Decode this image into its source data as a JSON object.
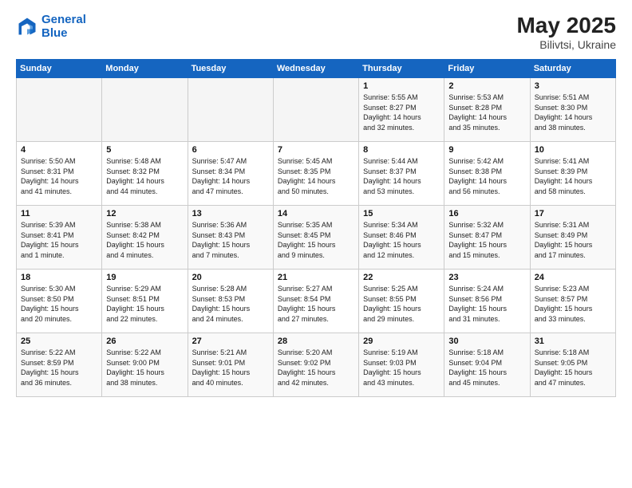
{
  "logo": {
    "line1": "General",
    "line2": "Blue"
  },
  "title": "May 2025",
  "subtitle": "Bilivtsi, Ukraine",
  "weekdays": [
    "Sunday",
    "Monday",
    "Tuesday",
    "Wednesday",
    "Thursday",
    "Friday",
    "Saturday"
  ],
  "weeks": [
    [
      {
        "day": "",
        "info": ""
      },
      {
        "day": "",
        "info": ""
      },
      {
        "day": "",
        "info": ""
      },
      {
        "day": "",
        "info": ""
      },
      {
        "day": "1",
        "info": "Sunrise: 5:55 AM\nSunset: 8:27 PM\nDaylight: 14 hours\nand 32 minutes."
      },
      {
        "day": "2",
        "info": "Sunrise: 5:53 AM\nSunset: 8:28 PM\nDaylight: 14 hours\nand 35 minutes."
      },
      {
        "day": "3",
        "info": "Sunrise: 5:51 AM\nSunset: 8:30 PM\nDaylight: 14 hours\nand 38 minutes."
      }
    ],
    [
      {
        "day": "4",
        "info": "Sunrise: 5:50 AM\nSunset: 8:31 PM\nDaylight: 14 hours\nand 41 minutes."
      },
      {
        "day": "5",
        "info": "Sunrise: 5:48 AM\nSunset: 8:32 PM\nDaylight: 14 hours\nand 44 minutes."
      },
      {
        "day": "6",
        "info": "Sunrise: 5:47 AM\nSunset: 8:34 PM\nDaylight: 14 hours\nand 47 minutes."
      },
      {
        "day": "7",
        "info": "Sunrise: 5:45 AM\nSunset: 8:35 PM\nDaylight: 14 hours\nand 50 minutes."
      },
      {
        "day": "8",
        "info": "Sunrise: 5:44 AM\nSunset: 8:37 PM\nDaylight: 14 hours\nand 53 minutes."
      },
      {
        "day": "9",
        "info": "Sunrise: 5:42 AM\nSunset: 8:38 PM\nDaylight: 14 hours\nand 56 minutes."
      },
      {
        "day": "10",
        "info": "Sunrise: 5:41 AM\nSunset: 8:39 PM\nDaylight: 14 hours\nand 58 minutes."
      }
    ],
    [
      {
        "day": "11",
        "info": "Sunrise: 5:39 AM\nSunset: 8:41 PM\nDaylight: 15 hours\nand 1 minute."
      },
      {
        "day": "12",
        "info": "Sunrise: 5:38 AM\nSunset: 8:42 PM\nDaylight: 15 hours\nand 4 minutes."
      },
      {
        "day": "13",
        "info": "Sunrise: 5:36 AM\nSunset: 8:43 PM\nDaylight: 15 hours\nand 7 minutes."
      },
      {
        "day": "14",
        "info": "Sunrise: 5:35 AM\nSunset: 8:45 PM\nDaylight: 15 hours\nand 9 minutes."
      },
      {
        "day": "15",
        "info": "Sunrise: 5:34 AM\nSunset: 8:46 PM\nDaylight: 15 hours\nand 12 minutes."
      },
      {
        "day": "16",
        "info": "Sunrise: 5:32 AM\nSunset: 8:47 PM\nDaylight: 15 hours\nand 15 minutes."
      },
      {
        "day": "17",
        "info": "Sunrise: 5:31 AM\nSunset: 8:49 PM\nDaylight: 15 hours\nand 17 minutes."
      }
    ],
    [
      {
        "day": "18",
        "info": "Sunrise: 5:30 AM\nSunset: 8:50 PM\nDaylight: 15 hours\nand 20 minutes."
      },
      {
        "day": "19",
        "info": "Sunrise: 5:29 AM\nSunset: 8:51 PM\nDaylight: 15 hours\nand 22 minutes."
      },
      {
        "day": "20",
        "info": "Sunrise: 5:28 AM\nSunset: 8:53 PM\nDaylight: 15 hours\nand 24 minutes."
      },
      {
        "day": "21",
        "info": "Sunrise: 5:27 AM\nSunset: 8:54 PM\nDaylight: 15 hours\nand 27 minutes."
      },
      {
        "day": "22",
        "info": "Sunrise: 5:25 AM\nSunset: 8:55 PM\nDaylight: 15 hours\nand 29 minutes."
      },
      {
        "day": "23",
        "info": "Sunrise: 5:24 AM\nSunset: 8:56 PM\nDaylight: 15 hours\nand 31 minutes."
      },
      {
        "day": "24",
        "info": "Sunrise: 5:23 AM\nSunset: 8:57 PM\nDaylight: 15 hours\nand 33 minutes."
      }
    ],
    [
      {
        "day": "25",
        "info": "Sunrise: 5:22 AM\nSunset: 8:59 PM\nDaylight: 15 hours\nand 36 minutes."
      },
      {
        "day": "26",
        "info": "Sunrise: 5:22 AM\nSunset: 9:00 PM\nDaylight: 15 hours\nand 38 minutes."
      },
      {
        "day": "27",
        "info": "Sunrise: 5:21 AM\nSunset: 9:01 PM\nDaylight: 15 hours\nand 40 minutes."
      },
      {
        "day": "28",
        "info": "Sunrise: 5:20 AM\nSunset: 9:02 PM\nDaylight: 15 hours\nand 42 minutes."
      },
      {
        "day": "29",
        "info": "Sunrise: 5:19 AM\nSunset: 9:03 PM\nDaylight: 15 hours\nand 43 minutes."
      },
      {
        "day": "30",
        "info": "Sunrise: 5:18 AM\nSunset: 9:04 PM\nDaylight: 15 hours\nand 45 minutes."
      },
      {
        "day": "31",
        "info": "Sunrise: 5:18 AM\nSunset: 9:05 PM\nDaylight: 15 hours\nand 47 minutes."
      }
    ]
  ]
}
